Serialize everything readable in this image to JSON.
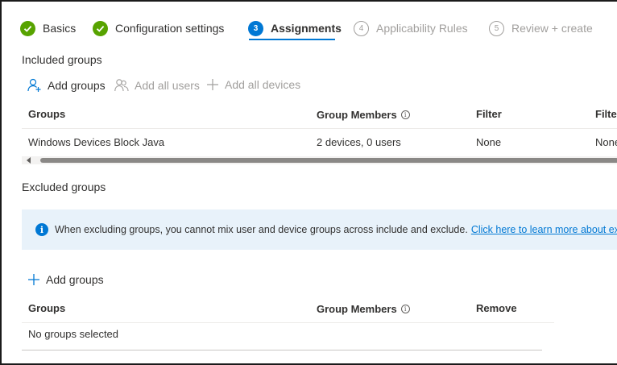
{
  "wizard": {
    "steps": [
      {
        "label": "Basics",
        "state": "completed",
        "icon": "checkmark-icon"
      },
      {
        "label": "Configuration settings",
        "state": "completed",
        "icon": "checkmark-icon"
      },
      {
        "label": "Assignments",
        "state": "current",
        "number": "3"
      },
      {
        "label": "Applicability Rules",
        "state": "pending",
        "number": "4"
      },
      {
        "label": "Review + create",
        "state": "pending",
        "number": "5"
      }
    ]
  },
  "included": {
    "title": "Included groups",
    "commands": {
      "add_groups": "Add groups",
      "add_all_users": "Add all users",
      "add_all_devices": "Add all devices"
    },
    "columns": [
      "Groups",
      "Group Members",
      "Filter",
      "Filter"
    ],
    "rows": [
      {
        "group": "Windows Devices Block Java",
        "members": "2 devices, 0 users",
        "filter": "None",
        "filter_mode": "None"
      }
    ]
  },
  "excluded": {
    "title": "Excluded groups",
    "banner": {
      "message": "When excluding groups, you cannot mix user and device groups across include and exclude.",
      "link": "Click here to learn more about excluding groups."
    },
    "commands": {
      "add_groups": "Add groups"
    },
    "columns": [
      "Groups",
      "Group Members",
      "Remove"
    ],
    "empty_text": "No groups selected"
  },
  "colors": {
    "accent": "#0078d4",
    "success": "#57a300",
    "disabled_text": "#a19f9d",
    "banner_bg": "#e8f2fa"
  }
}
